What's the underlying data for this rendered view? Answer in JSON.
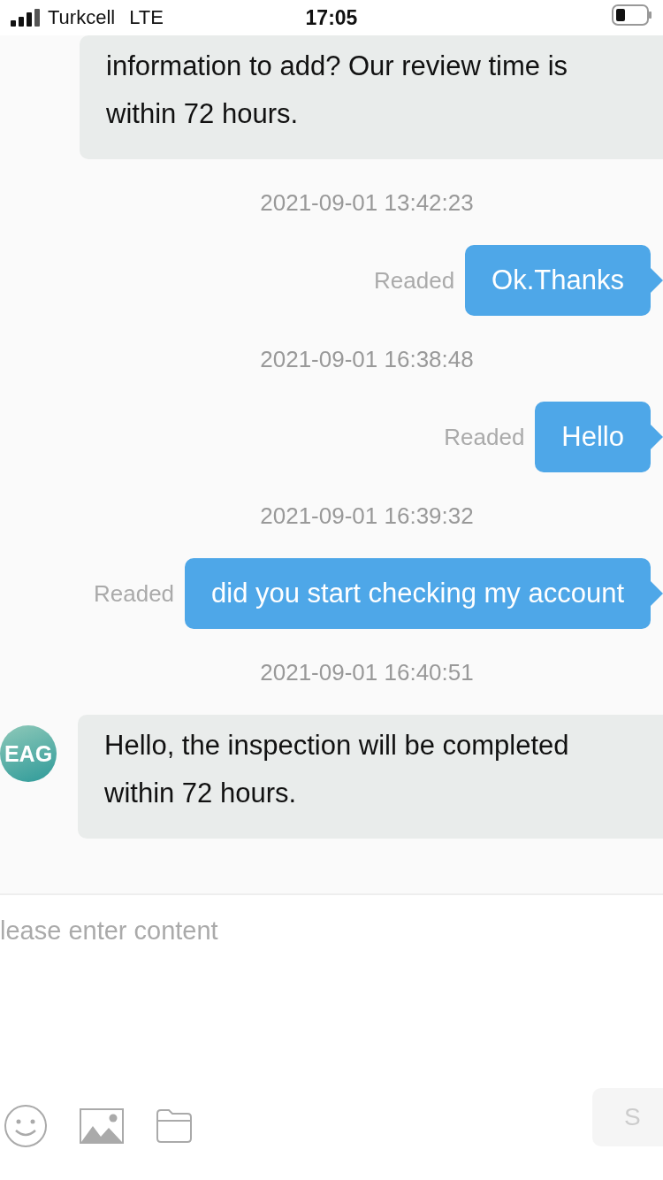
{
  "status_bar": {
    "carrier": "Turkcell",
    "network": "LTE",
    "time": "17:05"
  },
  "messages": [
    {
      "kind": "received",
      "text": "information to add? Our review time is within 72 hours."
    },
    {
      "kind": "timestamp",
      "text": "2021-09-01 13:42:23"
    },
    {
      "kind": "sent",
      "text": "Ok.Thanks",
      "status": "Readed"
    },
    {
      "kind": "timestamp",
      "text": "2021-09-01 16:38:48"
    },
    {
      "kind": "sent",
      "text": "Hello",
      "status": "Readed"
    },
    {
      "kind": "timestamp",
      "text": "2021-09-01 16:39:32"
    },
    {
      "kind": "sent",
      "text": "did you start checking my account",
      "status": "Readed"
    },
    {
      "kind": "timestamp",
      "text": "2021-09-01 16:40:51"
    },
    {
      "kind": "received",
      "avatar": "EAG",
      "text": "Hello, the inspection will be completed within 72 hours."
    }
  ],
  "composer": {
    "placeholder": "lease enter content",
    "send_label": "S"
  }
}
